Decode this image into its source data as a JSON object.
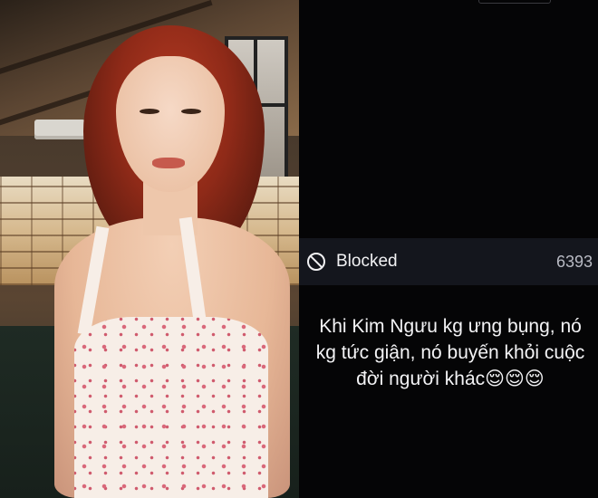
{
  "colors": {
    "panel_background": "#050506",
    "blocked_bar_background": "#14161d",
    "text_primary": "#f3f3f5",
    "text_secondary": "#b9bbc4"
  },
  "photo": {
    "subject": "woman-with-red-hair-portrait"
  },
  "status_bar": {
    "icon": "block-icon",
    "label": "Blocked",
    "count": "6393"
  },
  "post": {
    "text": "Khi Kim Ngưu kg ưng bụng, nó kg tức giận, nó buyến khỏi cuộc đời người khác😌😌😌"
  }
}
